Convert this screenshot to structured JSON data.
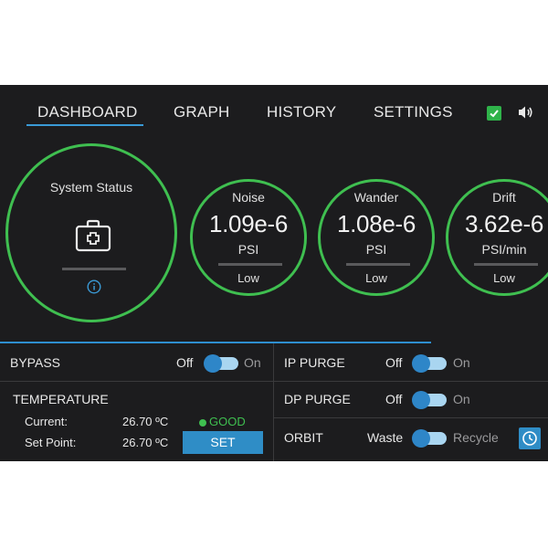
{
  "tabs": [
    {
      "label": "DASHBOARD",
      "active": true
    },
    {
      "label": "GRAPH"
    },
    {
      "label": "HISTORY"
    },
    {
      "label": "SETTINGS"
    }
  ],
  "header_icons": [
    "check-icon",
    "speaker-icon"
  ],
  "system_status": {
    "title": "System Status",
    "icon": "medical-kit-icon",
    "info_icon": "info-icon"
  },
  "gauges": [
    {
      "title": "Noise",
      "value": "1.09e-6",
      "unit": "PSI",
      "level": "Low"
    },
    {
      "title": "Wander",
      "value": "1.08e-6",
      "unit": "PSI",
      "level": "Low"
    },
    {
      "title": "Drift",
      "value": "3.62e-6",
      "unit": "PSI/min",
      "level": "Low"
    }
  ],
  "bypass": {
    "label": "BYPASS",
    "off": "Off",
    "on": "On"
  },
  "temperature": {
    "label": "TEMPERATURE",
    "current_label": "Current:",
    "current_value": "26.70 ºC",
    "setpoint_label": "Set Point:",
    "setpoint_value": "26.70 ºC",
    "status": "GOOD",
    "set_button": "SET"
  },
  "ip_purge": {
    "label": "IP PURGE",
    "off": "Off",
    "on": "On"
  },
  "dp_purge": {
    "label": "DP PURGE",
    "off": "Off",
    "on": "On"
  },
  "orbit": {
    "label": "ORBIT",
    "left": "Waste",
    "right": "Recycle",
    "icon": "clock-icon"
  },
  "colors": {
    "accent": "#2e86c8",
    "ok": "#3fbf50",
    "background": "#1c1c1e"
  }
}
